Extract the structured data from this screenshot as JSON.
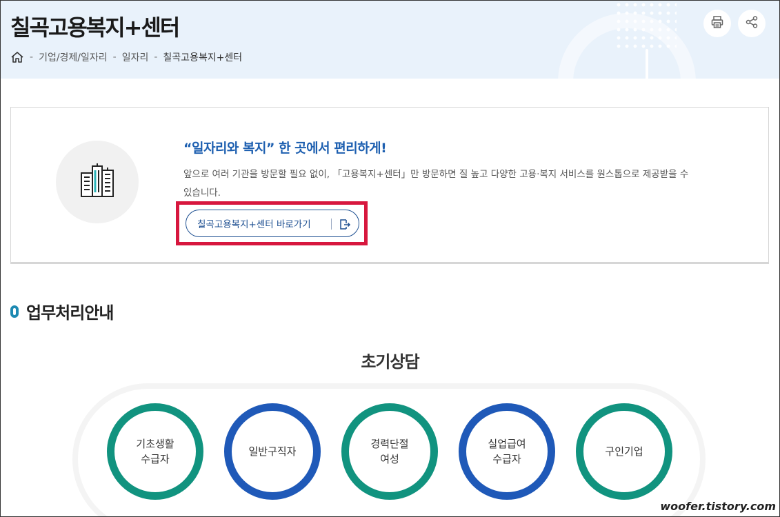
{
  "header": {
    "title": "칠곡고용복지+센터",
    "breadcrumb": [
      "기업/경제/일자리",
      "일자리",
      "칠곡고용복지+센터"
    ],
    "breadcrumb_separator": "-"
  },
  "intro": {
    "headline": "“일자리와 복지” 한 곳에서 편리하게!",
    "description": "앞으로 여러 기관을 방문할 필요 없이, 「고용복지+센터」만 방문하면 질 높고 다양한 고용·복지 서비스를 원스톱으로 제공받을 수 있습니다.",
    "button_label": "칠곡고용복지+센터 바로가기"
  },
  "section": {
    "title": "업무처리안내",
    "stage_title": "초기상담",
    "stages": [
      {
        "label": "기초생활\n수급자",
        "color": "#11937f"
      },
      {
        "label": "일반구직자",
        "color": "#1f59b8"
      },
      {
        "label": "경력단절\n여성",
        "color": "#11937f"
      },
      {
        "label": "실업급여\n수급자",
        "color": "#1f59b8"
      },
      {
        "label": "구인기업",
        "color": "#11937f"
      }
    ]
  },
  "watermark": "woofer.tistory.com",
  "colors": {
    "header_bg": "#e9f2fb",
    "headline_blue": "#1d5fb0",
    "highlight_red": "#d7173e",
    "green": "#11937f",
    "blue": "#1f59b8"
  }
}
